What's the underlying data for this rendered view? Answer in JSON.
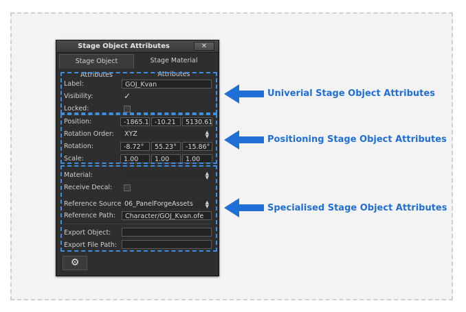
{
  "window": {
    "title": "Stage Object Attributes",
    "close_glyph": "✕"
  },
  "tabs": [
    {
      "label": "Stage Object Attributes"
    },
    {
      "label": "Stage Material Attributes"
    }
  ],
  "universal": {
    "label_label": "Label:",
    "label_value": "GOJ_Kvan",
    "visibility_label": "Visibility:",
    "visibility_checked": true,
    "locked_label": "Locked:",
    "locked_checked": false
  },
  "positioning": {
    "position_label": "Position:",
    "position_values": [
      "-1865.10",
      "-10.21",
      "5130.61"
    ],
    "rotation_order_label": "Rotation Order:",
    "rotation_order_value": "XYZ",
    "rotation_label": "Rotation:",
    "rotation_values": [
      "-8.72°",
      "55.23°",
      "-15.86°"
    ],
    "scale_label": "Scale:",
    "scale_values": [
      "1.00",
      "1.00",
      "1.00"
    ]
  },
  "specialised": {
    "material_label": "Material:",
    "material_value": "",
    "receive_decal_label": "Receive Decal:",
    "receive_decal_checked": false,
    "reference_source_label": "Reference Source:",
    "reference_source_value": "06_PanelForgeAssets",
    "reference_path_label": "Reference Path:",
    "reference_path_value": "Character/GOJ_Kvan.ofe",
    "export_object_label": "Export Object:",
    "export_object_value": "",
    "export_file_path_label": "Export File Path:",
    "export_file_path_value": ""
  },
  "footer": {
    "settings_icon": "gear-icon",
    "settings_glyph": "⚙"
  },
  "annotations": {
    "universal": "Univerial Stage Object Attributes",
    "positioning": "Positioning Stage Object Attributes",
    "specialised": "Specialised Stage Object Attributes",
    "color": "#1f6fd6",
    "highlight_color": "#3e8fe0"
  }
}
